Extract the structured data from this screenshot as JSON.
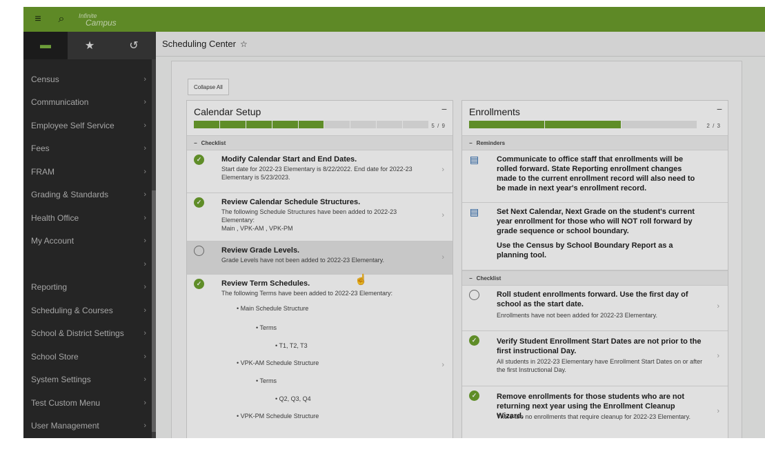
{
  "app": {
    "logo_top": "Infinite",
    "logo_bottom": "Campus",
    "accent": "#6b9d2c"
  },
  "sidebar": {
    "tabs": [
      {
        "name": "folder-icon",
        "glyph": "▬"
      },
      {
        "name": "star-icon",
        "glyph": "★"
      },
      {
        "name": "history-icon",
        "glyph": "↺"
      }
    ],
    "items": [
      {
        "label": "Census"
      },
      {
        "label": "Communication"
      },
      {
        "label": "Employee Self Service"
      },
      {
        "label": "Fees"
      },
      {
        "label": "FRAM"
      },
      {
        "label": "Grading & Standards"
      },
      {
        "label": "Health Office"
      },
      {
        "label": "My Account"
      },
      {
        "label": ""
      },
      {
        "label": "Reporting"
      },
      {
        "label": "Scheduling & Courses"
      },
      {
        "label": "School & District Settings"
      },
      {
        "label": "School Store"
      },
      {
        "label": "System Settings"
      },
      {
        "label": "Test Custom Menu"
      },
      {
        "label": "User Management"
      }
    ]
  },
  "header": {
    "title": "Scheduling Center",
    "star": "☆"
  },
  "content": {
    "collapse_all": "Collapse All",
    "calendar_setup": {
      "title": "Calendar Setup",
      "minimize": "−",
      "progress": {
        "done": 5,
        "total": 9
      },
      "count": "5 / 9",
      "section": "Checklist",
      "items": [
        {
          "status": "done",
          "title": "Modify Calendar Start and End Dates.",
          "desc": "Start date for 2022-23 Elementary is 8/22/2022. End date for 2022-23 Elementary is 5/23/2023."
        },
        {
          "status": "done",
          "title": "Review Calendar Schedule Structures.",
          "desc": "The following Schedule Structures have been added to 2022-23 Elementary:",
          "desc2": "Main , VPK-AM , VPK-PM"
        },
        {
          "status": "todo",
          "title": "Review Grade Levels.",
          "desc": "Grade Levels have not been added to 2022-23 Elementary."
        },
        {
          "status": "done",
          "title": "Review Term Schedules.",
          "desc": "The following Terms have been added to 2022-23 Elementary:",
          "bullets": [
            "Main Schedule Structure",
            "Terms",
            "T1, T2, T3",
            "VPK-AM Schedule Structure",
            "Terms",
            "Q2, Q3, Q4",
            "VPK-PM Schedule Structure"
          ]
        }
      ]
    },
    "enrollments": {
      "title": "Enrollments",
      "minimize": "−",
      "progress": {
        "done": 2,
        "total": 3
      },
      "count": "2 / 3",
      "reminders_section": "Reminders",
      "reminders": [
        {
          "text": "Communicate to office staff that enrollments will be rolled forward. State Reporting enrollment changes made to the current enrollment record will also need to be made in next year's enrollment record."
        },
        {
          "text": "Set Next Calendar, Next Grade on the student's current year enrollment for those who will NOT roll forward by grade sequence or school boundary.",
          "text2": "Use the Census by School Boundary Report as a planning tool."
        }
      ],
      "checklist_section": "Checklist",
      "items": [
        {
          "status": "todo",
          "title": "Roll student enrollments forward. Use the first day of school as the start date.",
          "desc": "Enrollments have not been added for 2022-23 Elementary."
        },
        {
          "status": "done",
          "title": "Verify Student Enrollment Start Dates are not prior to the first instructional Day.",
          "desc": "All students in 2022-23 Elementary have Enrollment Start Dates on or after the first Instructional Day."
        },
        {
          "status": "done",
          "title": "Remove enrollments for those students who are not returning next year using the Enrollment Cleanup Wizard.",
          "desc": "There are no enrollments that require cleanup for 2022-23 Elementary."
        }
      ]
    }
  }
}
